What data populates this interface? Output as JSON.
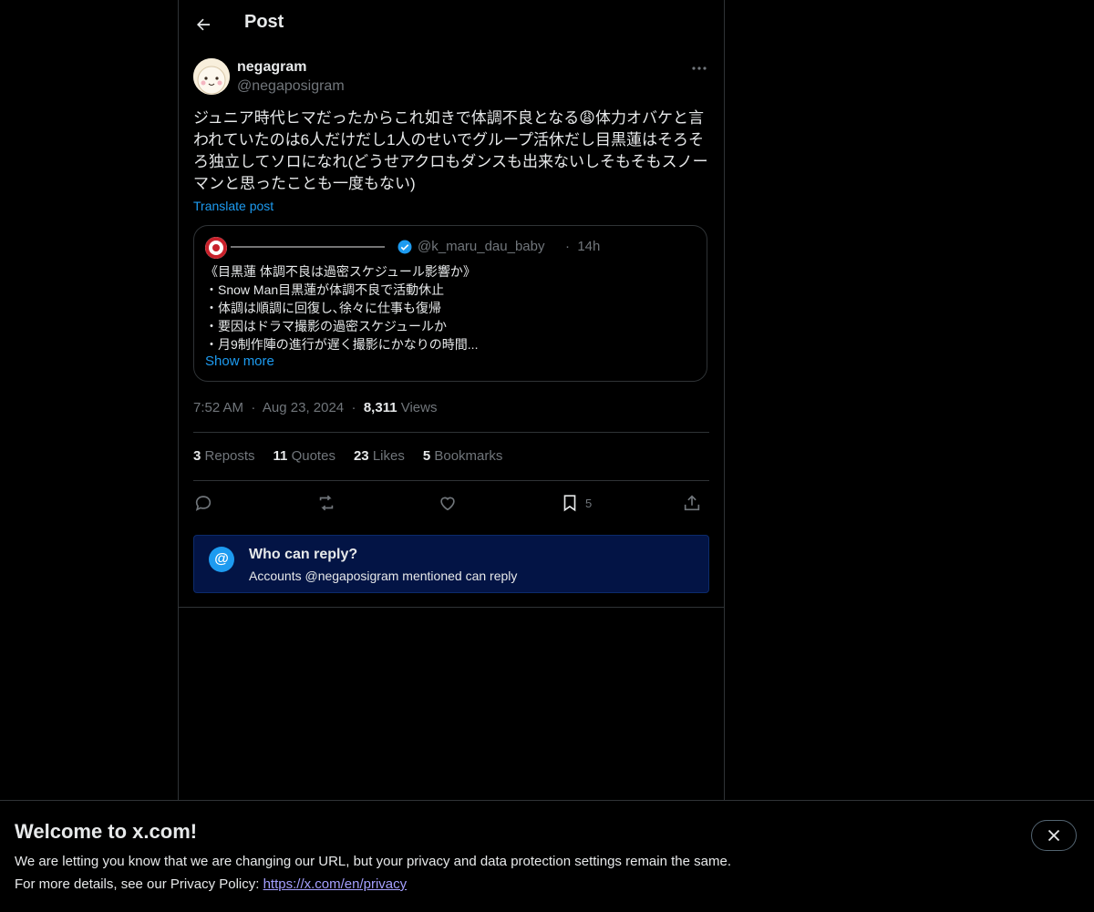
{
  "header": {
    "title": "Post"
  },
  "post": {
    "author_name": "negagram",
    "author_handle": "@negaposigram",
    "text": "ジュニア時代ヒマだったからこれ如きで体調不良となる😩体力オバケと言われていたのは6人だけだし1人のせいでグループ活休だし目黒蓮はそろそろ独立してソロになれ(どうせアクロもダンスも出来ないしそもそもスノーマンと思ったことも一度もない)",
    "translate_label": "Translate post",
    "time": "7:52 AM",
    "date": "Aug 23, 2024",
    "views_count": "8,311",
    "views_label": "Views",
    "separator": "·"
  },
  "quote": {
    "name": "————————————",
    "handle": "@k_maru_dau_baby",
    "separator": "·",
    "time": "14h",
    "lines": [
      "《目黒蓮 体調不良は過密スケジュール影響か》",
      "・Snow Man目黒蓮が体調不良で活動休止",
      "・体調は順調に回復し､徐々に仕事も復帰",
      "・要因はドラマ撮影の過密スケジュールか",
      "・月9制作陣の進行が遅く撮影にかなりの時間..."
    ],
    "show_more": "Show more"
  },
  "stats": {
    "reposts_count": "3",
    "reposts_label": "Reposts",
    "quotes_count": "11",
    "quotes_label": "Quotes",
    "likes_count": "23",
    "likes_label": "Likes",
    "bookmarks_count": "5",
    "bookmarks_label": "Bookmarks"
  },
  "actions": {
    "bookmark_count": "5"
  },
  "reply_restriction": {
    "icon": "@",
    "title": "Who can reply?",
    "subtitle": "Accounts @negaposigram mentioned can reply"
  },
  "banner": {
    "title": "Welcome to x.com!",
    "line1": "We are letting you know that we are changing our URL, but your privacy and data protection settings remain the same.",
    "line2_prefix": "For more details, see our Privacy Policy: ",
    "link": "https://x.com/en/privacy"
  },
  "colors": {
    "background": "#000000",
    "text": "#e7e9ea",
    "muted": "#71767b",
    "accent": "#1d9bf0",
    "reply_box": "#031445",
    "link": "#a5a0ff"
  },
  "icons": [
    "back-arrow-icon",
    "more-icon",
    "verified-icon",
    "reply-icon",
    "repost-icon",
    "like-icon",
    "bookmark-icon",
    "share-icon",
    "at-icon",
    "close-icon"
  ]
}
